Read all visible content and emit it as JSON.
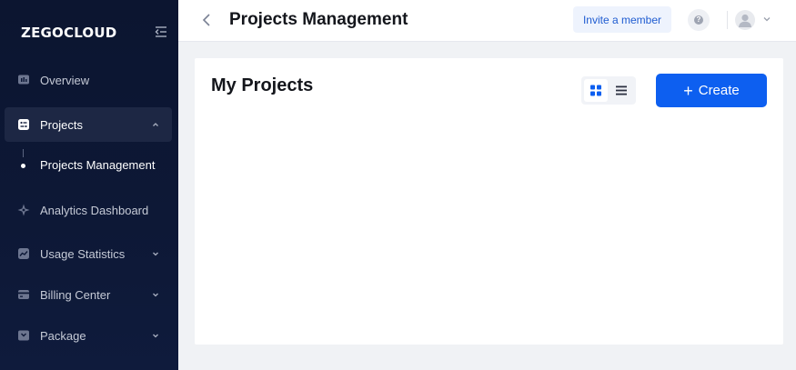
{
  "brand": {
    "logo_text": "ZEGOCLOUD"
  },
  "sidebar": {
    "items": [
      {
        "label": "Overview",
        "icon": "overview-icon",
        "expandable": false
      },
      {
        "label": "Projects",
        "icon": "projects-icon",
        "expandable": true,
        "expanded": true,
        "active": true
      },
      {
        "label": "Analytics Dashboard",
        "icon": "analytics-icon",
        "expandable": false
      },
      {
        "label": "Usage Statistics",
        "icon": "usage-icon",
        "expandable": true
      },
      {
        "label": "Billing Center",
        "icon": "billing-icon",
        "expandable": true
      },
      {
        "label": "Package",
        "icon": "package-icon",
        "expandable": true
      }
    ],
    "sub_items": [
      {
        "label": "Projects Management",
        "selected": true
      }
    ]
  },
  "header": {
    "title": "Projects Management",
    "invite_label": "Invite a member",
    "help_glyph": "?"
  },
  "main": {
    "title": "My Projects",
    "create_plus": "+",
    "create_label": "Create",
    "view_mode": "grid"
  },
  "colors": {
    "accent": "#0d5ff0",
    "sidebar_bg": "#0d1836",
    "page_bg": "#f0f2f5"
  }
}
